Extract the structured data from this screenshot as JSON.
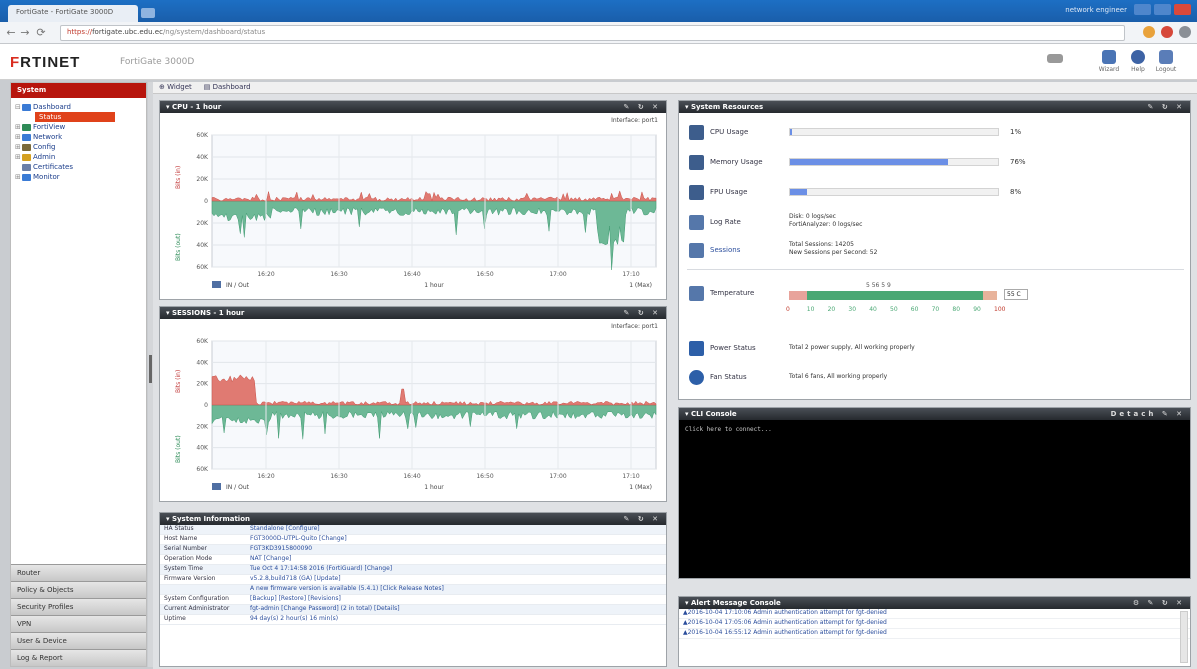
{
  "browser": {
    "tab_title": "FortiGate - FortiGate 3000D",
    "url_prefix": "https://",
    "url_host": "fortigate.ubc.edu.ec",
    "url_rest": "/ng/system/dashboard/status",
    "user_label": "network engineer"
  },
  "header": {
    "logo_forti": "F",
    "logo_rest": "RTINET",
    "model": "FortiGate 3000D",
    "icons": [
      {
        "name": "wizard-icon",
        "label": "Wizard"
      },
      {
        "name": "help-icon",
        "label": "Help"
      },
      {
        "name": "logout-icon",
        "label": "Logout"
      }
    ]
  },
  "sidebar": {
    "section": "System",
    "tree": [
      {
        "label": "Dashboard",
        "pm": "⊟",
        "color": "#3a7bd5"
      },
      {
        "label": "Status",
        "selected": true
      },
      {
        "label": "FortiView",
        "pm": "⊞",
        "color": "#2e8b57"
      },
      {
        "label": "Network",
        "pm": "⊞",
        "color": "#3a7bd5"
      },
      {
        "label": "Config",
        "pm": "⊞",
        "color": "#7a6a3a"
      },
      {
        "label": "Admin",
        "pm": "⊞",
        "color": "#d4a020"
      },
      {
        "label": "Certificates",
        "pm": "",
        "color": "#6a7fa8"
      },
      {
        "label": "Monitor",
        "pm": "⊞",
        "color": "#3a7bd5"
      }
    ],
    "bottom": [
      "Router",
      "Policy & Objects",
      "Security Profiles",
      "VPN",
      "User & Device",
      "Log & Report"
    ]
  },
  "toolbar": {
    "widget": "Widget",
    "dashboard": "Dashboard"
  },
  "cpu_widget": {
    "title": "CPU - 1 hour",
    "subtitle": "Interface: port1",
    "y_in": "Bits (in)",
    "y_out": "Bits (out)",
    "y_ticks": [
      "60K",
      "40K",
      "20K",
      "0",
      "20K",
      "40K",
      "60K"
    ],
    "x_ticks": [
      "16:20",
      "16:30",
      "16:40",
      "16:50",
      "17:00",
      "17:10"
    ],
    "legend_left": "IN / Out",
    "legend_mid": "1 hour",
    "legend_right": "1 (Max)"
  },
  "session_widget": {
    "title": "SESSIONS - 1 hour",
    "subtitle": "Interface: port1",
    "y_in": "Bits (in)",
    "y_out": "Bits (out)",
    "y_ticks": [
      "60K",
      "40K",
      "20K",
      "0",
      "20K",
      "40K",
      "60K"
    ],
    "x_ticks": [
      "16:20",
      "16:30",
      "16:40",
      "16:50",
      "17:00",
      "17:10"
    ],
    "legend_left": "IN / Out",
    "legend_mid": "1 hour",
    "legend_right": "1 (Max)"
  },
  "sysinfo": {
    "title": "System Information",
    "rows": [
      {
        "k": "HA Status",
        "v": "Standalone [Configure]"
      },
      {
        "k": "Host Name",
        "v": "FGT3000D-UTPL-Quito [Change]"
      },
      {
        "k": "Serial Number",
        "v": "FGT3KD3915800090"
      },
      {
        "k": "Operation Mode",
        "v": "NAT [Change]"
      },
      {
        "k": "System Time",
        "v": "Tue Oct 4 17:14:58 2016 (FortiGuard) [Change]"
      },
      {
        "k": "Firmware Version",
        "v": "v5.2.8,build718 (GA) [Update]"
      },
      {
        "k": "",
        "v": "A new firmware version is available (5.4.1) [Click Release Notes]"
      },
      {
        "k": "System Configuration",
        "v": "[Backup] [Restore] [Revisions]"
      },
      {
        "k": "Current Administrator",
        "v": "fgt-admin [Change Password] (2 in total) [Details]"
      },
      {
        "k": "Uptime",
        "v": "94 day(s) 2 hour(s) 16 min(s)"
      }
    ]
  },
  "resources": {
    "title": "System Resources",
    "cpu": {
      "label": "CPU Usage",
      "value": 1,
      "text": "1%"
    },
    "memory": {
      "label": "Memory Usage",
      "value": 76,
      "text": "76%"
    },
    "disk": {
      "label": "FPU Usage",
      "value": 8,
      "text": "8%"
    },
    "lograte_label": "Log Rate",
    "lograte_value1": "Disk: 0 logs/sec",
    "lograte_value2": "FortiAnalyzer: 0 logs/sec",
    "sessions_label": "Sessions",
    "sessions_value1": "Total Sessions: 14205",
    "sessions_value2": "New Sessions per Second: 52",
    "temp_label": "Temperature",
    "temp_value": "55 C",
    "temp_ticks": [
      "0",
      "10",
      "20",
      "30",
      "40",
      "50",
      "60",
      "70",
      "80",
      "90",
      "100"
    ],
    "temp_markers": "5 56 5 9",
    "power_label": "Power Status",
    "power_value": "Total 2 power supply, All working properly",
    "fan_label": "Fan Status",
    "fan_value": "Total 6 fans, All working properly"
  },
  "cli": {
    "title": "CLI Console",
    "detach": "Detach",
    "prompt": "Click here to connect..."
  },
  "alerts": {
    "title": "Alert Message Console",
    "rows": [
      "▲2016-10-04 17:10:06 Admin authentication attempt for fgt-denied",
      "▲2016-10-04 17:05:06 Admin authentication attempt for fgt-denied",
      "▲2016-10-04 16:55:12 Admin authentication attempt for fgt-denied"
    ]
  },
  "colors": {
    "in_area": "#e07a72",
    "out_area": "#6db896",
    "accent_red": "#b7150d",
    "bar_blue": "#6b8fe6"
  }
}
